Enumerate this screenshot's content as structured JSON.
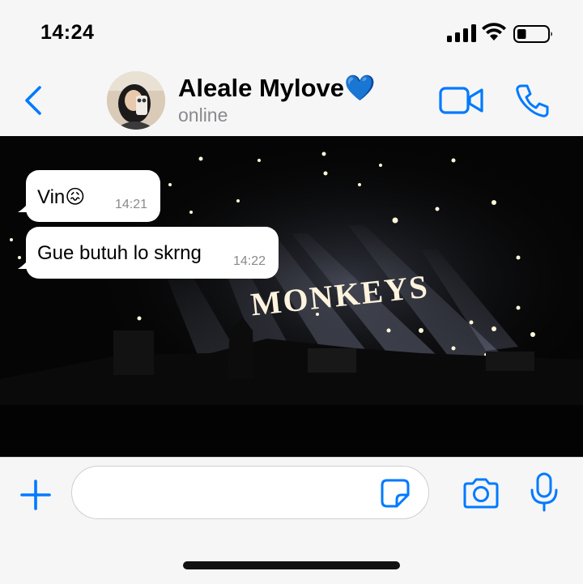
{
  "status_bar": {
    "time": "14:24",
    "icons": [
      "cellular-signal-icon",
      "wifi-icon",
      "battery-icon"
    ],
    "battery_level": 0.3
  },
  "header": {
    "back_icon": "chevron-left-icon",
    "contact_name": "Aleale Mylove💙",
    "contact_status": "online",
    "video_call_icon": "video-camera-icon",
    "voice_call_icon": "phone-icon"
  },
  "messages": [
    {
      "text": "Vin😖",
      "time": "14:21",
      "direction": "incoming"
    },
    {
      "text": "Gue butuh lo skrng",
      "time": "14:22",
      "direction": "incoming"
    }
  ],
  "wallpaper": {
    "description_text": "MONKEYS"
  },
  "composer": {
    "input_value": "",
    "input_placeholder": "",
    "icons": [
      "plus-icon",
      "sticker-icon",
      "camera-icon",
      "microphone-icon"
    ]
  },
  "colors": {
    "accent": "#007aff",
    "bubble": "#ffffff",
    "background": "#f6f6f6",
    "secondary_text": "#8a8a8e"
  }
}
